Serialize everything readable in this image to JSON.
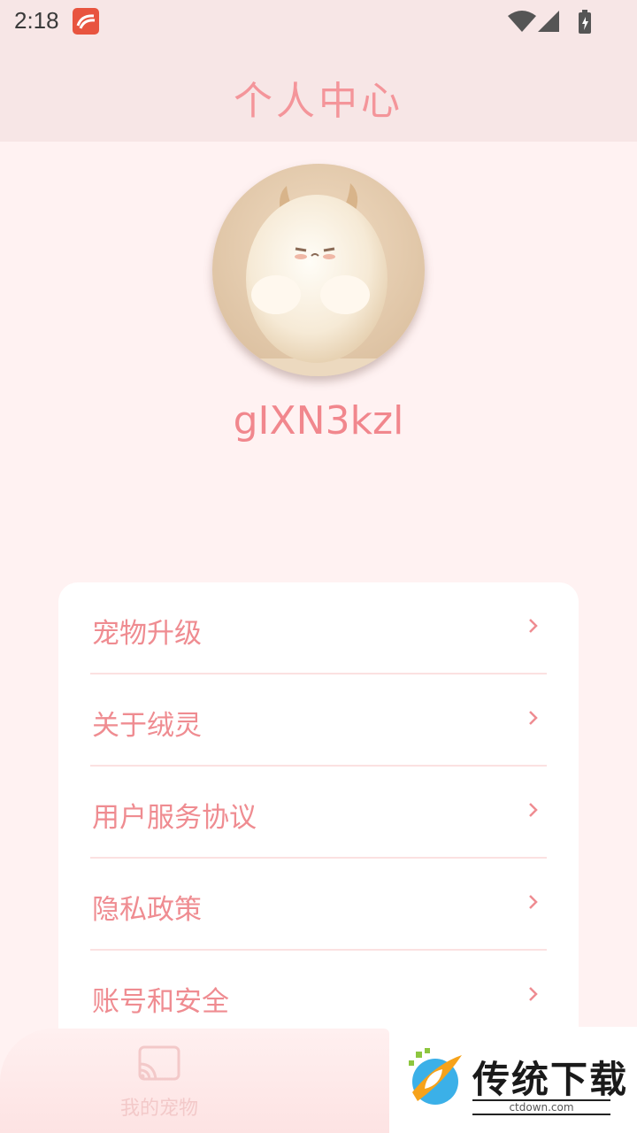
{
  "status_bar": {
    "time": "2:18",
    "icons": [
      "app-notification-icon",
      "wifi-icon",
      "signal-icon",
      "battery-charging-icon"
    ]
  },
  "header": {
    "title": "个人中心"
  },
  "profile": {
    "username": "gIXN3kzl",
    "avatar_icon": "fluffy-pet-avatar"
  },
  "menu": {
    "items": [
      {
        "label": "宠物升级"
      },
      {
        "label": "关于绒灵"
      },
      {
        "label": "用户服务协议"
      },
      {
        "label": "隐私政策"
      },
      {
        "label": "账号和安全"
      }
    ]
  },
  "bottom_nav": {
    "tab_pets_label": "我的宠物",
    "tab_pets_icon": "cast-screen-icon"
  },
  "watermark": {
    "brand": "传统下载",
    "site": "ctdown.com"
  },
  "colors": {
    "accent": "#f1878d",
    "background": "#fff2f2",
    "header_bg": "#f7e6e6"
  }
}
